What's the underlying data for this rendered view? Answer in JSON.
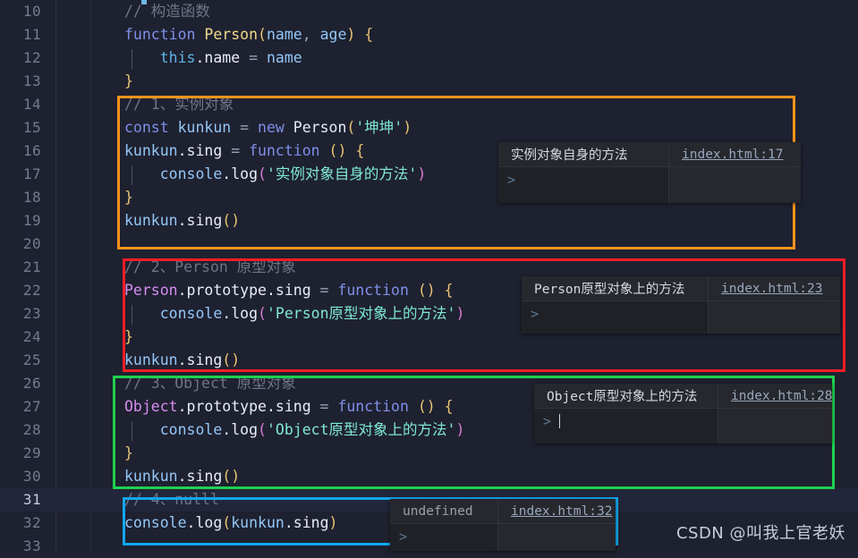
{
  "editor": {
    "first_line_number": 10,
    "active_line": 31,
    "lines": [
      {
        "n": 10,
        "indent": false,
        "tokens": [
          {
            "c": "t-comment",
            "t": "// 构造函数"
          }
        ]
      },
      {
        "n": 11,
        "indent": false,
        "tokens": [
          {
            "c": "t-kw",
            "t": "function"
          },
          {
            "c": "t-op",
            "t": " "
          },
          {
            "c": "t-fname",
            "t": "Person"
          },
          {
            "c": "t-paren",
            "t": "("
          },
          {
            "c": "t-var",
            "t": "name"
          },
          {
            "c": "t-op",
            "t": ", "
          },
          {
            "c": "t-var",
            "t": "age"
          },
          {
            "c": "t-paren",
            "t": ")"
          },
          {
            "c": "t-op",
            "t": " "
          },
          {
            "c": "t-paren",
            "t": "{"
          }
        ]
      },
      {
        "n": 12,
        "indent": true,
        "tokens": [
          {
            "c": "t-op",
            "t": "    "
          },
          {
            "c": "t-this",
            "t": "this"
          },
          {
            "c": "t-prop",
            "t": ".name"
          },
          {
            "c": "t-op",
            "t": " = "
          },
          {
            "c": "t-var",
            "t": "name"
          }
        ]
      },
      {
        "n": 13,
        "indent": false,
        "tokens": [
          {
            "c": "t-paren",
            "t": "}"
          }
        ]
      },
      {
        "n": 14,
        "indent": false,
        "tokens": [
          {
            "c": "t-comment",
            "t": "// 1、实例对象"
          }
        ]
      },
      {
        "n": 15,
        "indent": false,
        "tokens": [
          {
            "c": "t-kw",
            "t": "const"
          },
          {
            "c": "t-op",
            "t": " "
          },
          {
            "c": "t-var",
            "t": "kunkun"
          },
          {
            "c": "t-op",
            "t": " = "
          },
          {
            "c": "t-kw",
            "t": "new"
          },
          {
            "c": "t-op",
            "t": " "
          },
          {
            "c": "t-white",
            "t": "Person"
          },
          {
            "c": "t-paren",
            "t": "("
          },
          {
            "c": "t-str",
            "t": "'坤坤'"
          },
          {
            "c": "t-paren",
            "t": ")"
          }
        ]
      },
      {
        "n": 16,
        "indent": false,
        "tokens": [
          {
            "c": "t-var",
            "t": "kunkun"
          },
          {
            "c": "t-prop",
            "t": ".sing"
          },
          {
            "c": "t-op",
            "t": " = "
          },
          {
            "c": "t-kw",
            "t": "function"
          },
          {
            "c": "t-op",
            "t": " "
          },
          {
            "c": "t-paren",
            "t": "()"
          },
          {
            "c": "t-op",
            "t": " "
          },
          {
            "c": "t-paren",
            "t": "{"
          }
        ]
      },
      {
        "n": 17,
        "indent": true,
        "tokens": [
          {
            "c": "t-op",
            "t": "    "
          },
          {
            "c": "t-var",
            "t": "console"
          },
          {
            "c": "t-prop",
            "t": ".log"
          },
          {
            "c": "t-paren2",
            "t": "("
          },
          {
            "c": "t-str",
            "t": "'实例对象自身的方法'"
          },
          {
            "c": "t-paren2",
            "t": ")"
          }
        ]
      },
      {
        "n": 18,
        "indent": false,
        "tokens": [
          {
            "c": "t-paren",
            "t": "}"
          }
        ]
      },
      {
        "n": 19,
        "indent": false,
        "tokens": [
          {
            "c": "t-var",
            "t": "kunkun"
          },
          {
            "c": "t-prop",
            "t": ".sing"
          },
          {
            "c": "t-paren",
            "t": "()"
          }
        ]
      },
      {
        "n": 20,
        "indent": false,
        "tokens": []
      },
      {
        "n": 21,
        "indent": false,
        "tokens": [
          {
            "c": "t-comment",
            "t": "// 2、Person 原型对象"
          }
        ]
      },
      {
        "n": 22,
        "indent": false,
        "tokens": [
          {
            "c": "t-class",
            "t": "Person"
          },
          {
            "c": "t-prop",
            "t": ".prototype"
          },
          {
            "c": "t-prop",
            "t": ".sing"
          },
          {
            "c": "t-op",
            "t": " = "
          },
          {
            "c": "t-kw",
            "t": "function"
          },
          {
            "c": "t-op",
            "t": " "
          },
          {
            "c": "t-paren",
            "t": "()"
          },
          {
            "c": "t-op",
            "t": " "
          },
          {
            "c": "t-paren",
            "t": "{"
          }
        ]
      },
      {
        "n": 23,
        "indent": true,
        "tokens": [
          {
            "c": "t-op",
            "t": "    "
          },
          {
            "c": "t-var",
            "t": "console"
          },
          {
            "c": "t-prop",
            "t": ".log"
          },
          {
            "c": "t-paren2",
            "t": "("
          },
          {
            "c": "t-str",
            "t": "'Person原型对象上的方法'"
          },
          {
            "c": "t-paren2",
            "t": ")"
          }
        ]
      },
      {
        "n": 24,
        "indent": false,
        "tokens": [
          {
            "c": "t-paren",
            "t": "}"
          }
        ]
      },
      {
        "n": 25,
        "indent": false,
        "tokens": [
          {
            "c": "t-var",
            "t": "kunkun"
          },
          {
            "c": "t-prop",
            "t": ".sing"
          },
          {
            "c": "t-paren",
            "t": "()"
          }
        ]
      },
      {
        "n": 26,
        "indent": false,
        "tokens": [
          {
            "c": "t-comment",
            "t": "// 3、Object 原型对象"
          }
        ]
      },
      {
        "n": 27,
        "indent": false,
        "tokens": [
          {
            "c": "t-class",
            "t": "Object"
          },
          {
            "c": "t-prop",
            "t": ".prototype"
          },
          {
            "c": "t-prop",
            "t": ".sing"
          },
          {
            "c": "t-op",
            "t": " = "
          },
          {
            "c": "t-kw",
            "t": "function"
          },
          {
            "c": "t-op",
            "t": " "
          },
          {
            "c": "t-paren",
            "t": "()"
          },
          {
            "c": "t-op",
            "t": " "
          },
          {
            "c": "t-paren",
            "t": "{"
          }
        ]
      },
      {
        "n": 28,
        "indent": true,
        "tokens": [
          {
            "c": "t-op",
            "t": "    "
          },
          {
            "c": "t-var",
            "t": "console"
          },
          {
            "c": "t-prop",
            "t": ".log"
          },
          {
            "c": "t-paren2",
            "t": "("
          },
          {
            "c": "t-str",
            "t": "'Object原型对象上的方法'"
          },
          {
            "c": "t-paren2",
            "t": ")"
          }
        ]
      },
      {
        "n": 29,
        "indent": false,
        "tokens": [
          {
            "c": "t-paren",
            "t": "}"
          }
        ]
      },
      {
        "n": 30,
        "indent": false,
        "tokens": [
          {
            "c": "t-var",
            "t": "kunkun"
          },
          {
            "c": "t-prop",
            "t": ".sing"
          },
          {
            "c": "t-paren",
            "t": "()"
          }
        ]
      },
      {
        "n": 31,
        "indent": false,
        "tokens": [
          {
            "c": "t-comment",
            "t": "// 4、nulll"
          }
        ]
      },
      {
        "n": 32,
        "indent": false,
        "tokens": [
          {
            "c": "t-var",
            "t": "console"
          },
          {
            "c": "t-prop",
            "t": ".log"
          },
          {
            "c": "t-paren",
            "t": "("
          },
          {
            "c": "t-var",
            "t": "kunkun"
          },
          {
            "c": "t-prop",
            "t": ".sing"
          },
          {
            "c": "t-paren",
            "t": ")"
          }
        ]
      },
      {
        "n": 33,
        "indent": false,
        "tokens": []
      }
    ]
  },
  "highlights": [
    {
      "name": "instance-object-highlight",
      "color": "#f7941d",
      "label": "orange"
    },
    {
      "name": "person-prototype-highlight",
      "color": "#fc1d26",
      "label": "red"
    },
    {
      "name": "object-prototype-highlight",
      "color": "#1fd14f",
      "label": "green"
    },
    {
      "name": "null-case-highlight",
      "color": "#12a7f0",
      "label": "blue"
    }
  ],
  "console_panels": [
    {
      "id": "panel1",
      "message": "实例对象自身的方法",
      "source": "index.html:17",
      "prompt": ">",
      "has_caret": false
    },
    {
      "id": "panel2",
      "message": "Person原型对象上的方法",
      "source": "index.html:23",
      "prompt": ">",
      "has_caret": false
    },
    {
      "id": "panel3",
      "message": "Object原型对象上的方法",
      "source": "index.html:28",
      "prompt": ">",
      "has_caret": true
    },
    {
      "id": "panel4",
      "message": "undefined",
      "source": "index.html:32",
      "prompt": ">",
      "has_caret": false
    }
  ],
  "watermark": {
    "text": "CSDN @叫我上官老妖"
  }
}
